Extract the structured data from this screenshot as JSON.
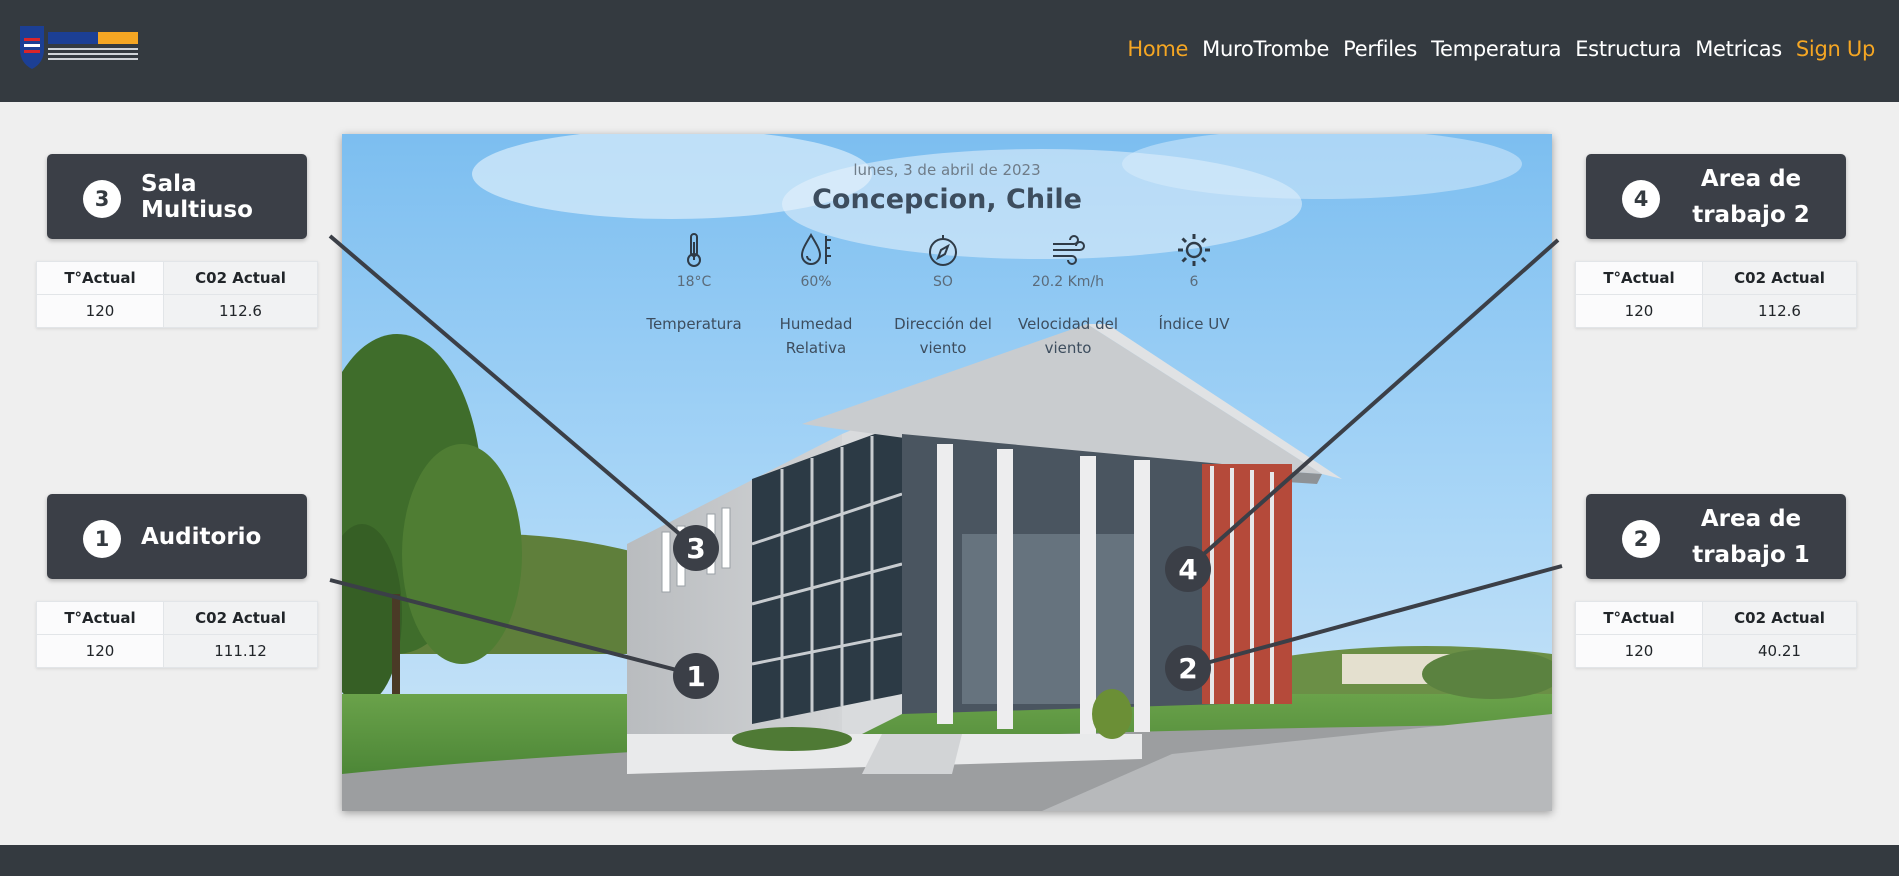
{
  "navbar": {
    "brand": "CITEC UBB",
    "links": [
      {
        "label": "Home",
        "active": true
      },
      {
        "label": "MuroTrombe"
      },
      {
        "label": "Perfiles"
      },
      {
        "label": "Temperatura"
      },
      {
        "label": "Estructura"
      },
      {
        "label": "Metricas"
      },
      {
        "label": "Sign Up",
        "accent": true
      }
    ],
    "accent_color": "#f5a623",
    "background_color": "#343a40"
  },
  "weather": {
    "date": "lunes, 3 de abril de 2023",
    "city": "Concepcion, Chile",
    "items": [
      {
        "icon": "thermometer-icon",
        "value": "18°C",
        "name": "Temperatura"
      },
      {
        "icon": "humidity-icon",
        "value": "60%",
        "name": "Humedad Relativa"
      },
      {
        "icon": "compass-icon",
        "value": "SO",
        "name": "Dirección del viento"
      },
      {
        "icon": "wind-icon",
        "value": "20.2 Km/h",
        "name": "Velocidad del viento"
      },
      {
        "icon": "sun-icon",
        "value": "6",
        "name": "Índice UV"
      }
    ]
  },
  "table_headers": {
    "col1": "T°Actual",
    "col2": "C02 Actual"
  },
  "rooms": [
    {
      "number": "3",
      "name": "Sala Multiuso",
      "temp": "120",
      "co2": "112.6"
    },
    {
      "number": "1",
      "name": "Auditorio",
      "temp": "120",
      "co2": "111.12"
    },
    {
      "number": "4",
      "name": "Area de trabajo 2",
      "temp": "120",
      "co2": "112.6"
    },
    {
      "number": "2",
      "name": "Area de trabajo 1",
      "temp": "120",
      "co2": "40.21"
    }
  ],
  "markers": [
    "3",
    "1",
    "4",
    "2"
  ]
}
